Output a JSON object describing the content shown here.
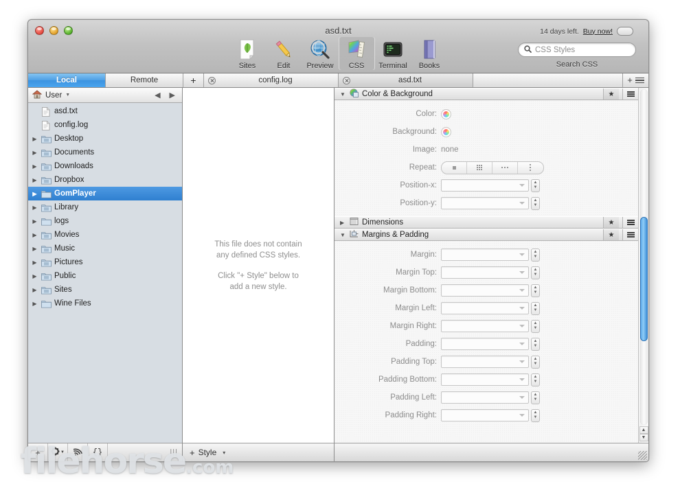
{
  "window": {
    "title": "asd.txt",
    "trial_text": "14 days left.",
    "buy_link": "Buy now!"
  },
  "search": {
    "placeholder": "CSS Styles",
    "icon": "search-icon",
    "label": "Search CSS"
  },
  "toolbar": {
    "items": [
      {
        "label": "Sites",
        "icon": "leaf-page-icon",
        "selected": false
      },
      {
        "label": "Edit",
        "icon": "pencil-icon",
        "selected": false
      },
      {
        "label": "Preview",
        "icon": "globe-magnifier-icon",
        "selected": false
      },
      {
        "label": "CSS",
        "icon": "color-ruler-icon",
        "selected": true
      },
      {
        "label": "Terminal",
        "icon": "terminal-icon",
        "selected": false
      },
      {
        "label": "Books",
        "icon": "book-icon",
        "selected": false
      }
    ]
  },
  "tabstrip": {
    "local_label": "Local",
    "remote_label": "Remote",
    "add_label": "+",
    "documents": [
      {
        "name": "config.log",
        "active": false
      },
      {
        "name": "asd.txt",
        "active": true
      }
    ],
    "add_panel_icon": "plus-icon",
    "panel_menu_icon": "hamburger-icon"
  },
  "sidebar": {
    "header": {
      "root": "User",
      "home_icon": "home-icon",
      "menu_icon": "chevron-down-icon",
      "back_icon": "back-arrow-icon",
      "forward_icon": "forward-arrow-icon"
    },
    "items": [
      {
        "label": "asd.txt",
        "type": "file",
        "icon": "file-icon",
        "expandable": false,
        "selected": false
      },
      {
        "label": "config.log",
        "type": "file",
        "icon": "file-icon",
        "expandable": false,
        "selected": false
      },
      {
        "label": "Desktop",
        "type": "folder",
        "icon": "folder-desktop-icon",
        "expandable": true,
        "selected": false
      },
      {
        "label": "Documents",
        "type": "folder",
        "icon": "folder-documents-icon",
        "expandable": true,
        "selected": false
      },
      {
        "label": "Downloads",
        "type": "folder",
        "icon": "folder-downloads-icon",
        "expandable": true,
        "selected": false
      },
      {
        "label": "Dropbox",
        "type": "folder",
        "icon": "folder-dropbox-icon",
        "expandable": true,
        "selected": false
      },
      {
        "label": "GomPlayer",
        "type": "folder",
        "icon": "folder-icon",
        "expandable": true,
        "selected": true
      },
      {
        "label": "Library",
        "type": "folder",
        "icon": "folder-library-icon",
        "expandable": true,
        "selected": false
      },
      {
        "label": "logs",
        "type": "folder",
        "icon": "folder-icon",
        "expandable": true,
        "selected": false
      },
      {
        "label": "Movies",
        "type": "folder",
        "icon": "folder-movies-icon",
        "expandable": true,
        "selected": false
      },
      {
        "label": "Music",
        "type": "folder",
        "icon": "folder-music-icon",
        "expandable": true,
        "selected": false
      },
      {
        "label": "Pictures",
        "type": "folder",
        "icon": "folder-pictures-icon",
        "expandable": true,
        "selected": false
      },
      {
        "label": "Public",
        "type": "folder",
        "icon": "folder-public-icon",
        "expandable": true,
        "selected": false
      },
      {
        "label": "Sites",
        "type": "folder",
        "icon": "folder-sites-icon",
        "expandable": true,
        "selected": false
      },
      {
        "label": "Wine Files",
        "type": "folder",
        "icon": "folder-icon",
        "expandable": true,
        "selected": false
      }
    ],
    "footer_buttons": [
      {
        "icon": "plus-icon",
        "label": "+"
      },
      {
        "icon": "gear-icon",
        "label": "⚙"
      },
      {
        "icon": "rss-icon",
        "label": "ᴰ"
      },
      {
        "icon": "braces-icon",
        "label": "{}"
      }
    ],
    "grip_icon": "resize-grip-icon"
  },
  "center": {
    "empty_line1": "This file does not contain",
    "empty_line2": "any defined CSS styles.",
    "empty_line3": "Click \"+ Style\" below to",
    "empty_line4": "add a new style.",
    "add_style_label": "Style",
    "add_style_plus": "+",
    "add_style_caret": "▾"
  },
  "inspector": {
    "sections": [
      {
        "title": "Color & Background",
        "icon": "color-background-icon",
        "expanded": true,
        "favorite_icon": "star-icon",
        "menu_icon": "hamburger-icon",
        "fields": [
          {
            "label": "Color:",
            "kind": "colorwell",
            "value": ""
          },
          {
            "label": "Background:",
            "kind": "colorwell",
            "value": ""
          },
          {
            "label": "Image:",
            "kind": "text",
            "value": "none"
          },
          {
            "label": "Repeat:",
            "kind": "segmented",
            "options": [
              "no-repeat",
              "repeat",
              "repeat-x",
              "repeat-y"
            ],
            "selected": -1
          },
          {
            "label": "Position-x:",
            "kind": "combo",
            "value": ""
          },
          {
            "label": "Position-y:",
            "kind": "combo",
            "value": ""
          }
        ]
      },
      {
        "title": "Dimensions",
        "icon": "dimensions-icon",
        "expanded": false,
        "favorite_icon": "star-icon",
        "menu_icon": "hamburger-icon",
        "fields": []
      },
      {
        "title": "Margins & Padding",
        "icon": "margins-padding-icon",
        "expanded": true,
        "favorite_icon": "star-icon",
        "menu_icon": "hamburger-icon",
        "fields": [
          {
            "label": "Margin:",
            "kind": "combo",
            "value": ""
          },
          {
            "label": "Margin Top:",
            "kind": "combo",
            "value": ""
          },
          {
            "label": "Margin Bottom:",
            "kind": "combo",
            "value": ""
          },
          {
            "label": "Margin Left:",
            "kind": "combo",
            "value": ""
          },
          {
            "label": "Margin Right:",
            "kind": "combo",
            "value": ""
          },
          {
            "label": "Padding:",
            "kind": "combo",
            "value": ""
          },
          {
            "label": "Padding Top:",
            "kind": "combo",
            "value": ""
          },
          {
            "label": "Padding Bottom:",
            "kind": "combo",
            "value": ""
          },
          {
            "label": "Padding Left:",
            "kind": "combo",
            "value": ""
          },
          {
            "label": "Padding Right:",
            "kind": "combo",
            "value": ""
          }
        ]
      }
    ],
    "scrollbar": {
      "up_arrow": "▲",
      "down_arrow": "▼"
    }
  },
  "watermark": {
    "name": "filehorse",
    "suffix": ".com"
  },
  "colors": {
    "selection_blue": "#3d8fdd",
    "tab_active_blue": "#4d9fe5",
    "scroll_thumb": "#5aa7e8",
    "window_chrome": "#c2c2c2",
    "sidebar_bg": "#d7dde3"
  }
}
